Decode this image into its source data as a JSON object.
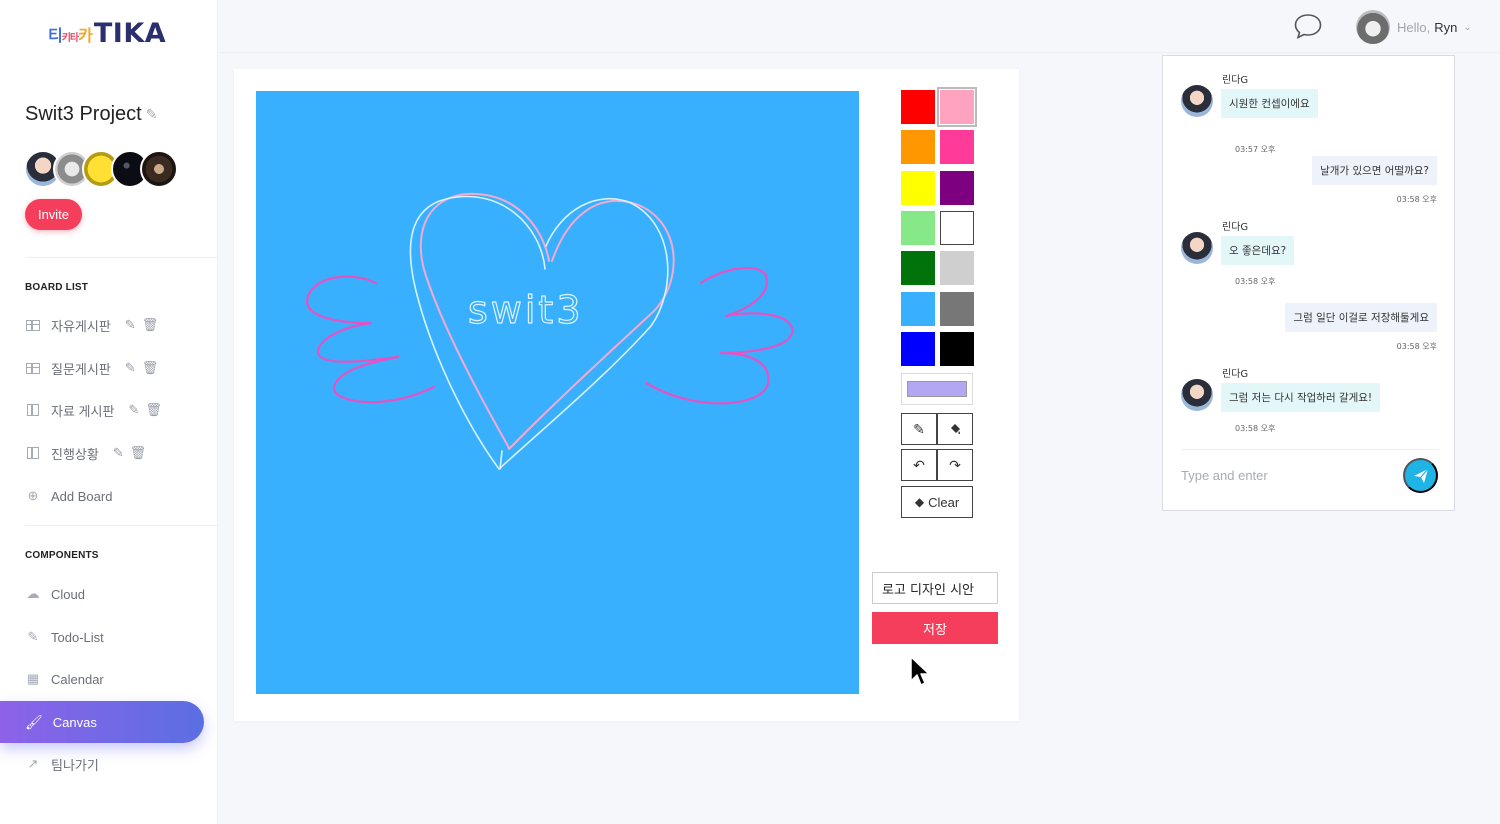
{
  "logo": {
    "small_1": "티",
    "small_2": "키타",
    "small_3": "카",
    "main": "TIKA"
  },
  "project": {
    "name": "Swit3 Project"
  },
  "invite_label": "Invite",
  "board_list": {
    "title": "BOARD LIST",
    "items": [
      {
        "label": "자유게시판"
      },
      {
        "label": "질문게시판"
      },
      {
        "label": "자료 게시판"
      },
      {
        "label": "진행상황"
      }
    ],
    "add_label": "Add Board"
  },
  "components": {
    "title": "COMPONENTS",
    "items": [
      {
        "label": "Cloud"
      },
      {
        "label": "Todo-List"
      },
      {
        "label": "Calendar"
      },
      {
        "label": "Canvas"
      },
      {
        "label": "팀나가기"
      }
    ]
  },
  "user": {
    "hello": "Hello,",
    "name": "Ryn"
  },
  "palette": {
    "colors": [
      "#ff0000",
      "#ffa3c0",
      "#ff9800",
      "#ff3a99",
      "#ffff00",
      "#7d0080",
      "#86e886",
      "#ffffff",
      "#00730a",
      "#cfcfcf",
      "#38b0fe",
      "#777777",
      "#0000ff",
      "#000000"
    ],
    "selected": "#ffa3c0",
    "current": "#b4a7f2"
  },
  "canvas": {
    "background": "#38b0fe",
    "text": "swit3"
  },
  "tools": {
    "clear_label": "Clear"
  },
  "drawing_title": "로고 디자인 시안",
  "save_label": "저장",
  "chat": {
    "messages": [
      {
        "sender": "린다G",
        "text": "시원한 컨셉이에요",
        "time": "03:57 오후"
      },
      {
        "text": "날개가 있으면 어떨까요?",
        "time": "03:58 오후"
      },
      {
        "sender": "린다G",
        "text": "오 좋은데요?",
        "time": "03:58 오후"
      },
      {
        "text": "그럼 일단 이걸로 저장해둘게요",
        "time": "03:58 오후"
      },
      {
        "sender": "린다G",
        "text": "그럼 저는 다시 작업하러 갈게요!",
        "time": "03:58 오후"
      }
    ],
    "placeholder": "Type and enter"
  }
}
